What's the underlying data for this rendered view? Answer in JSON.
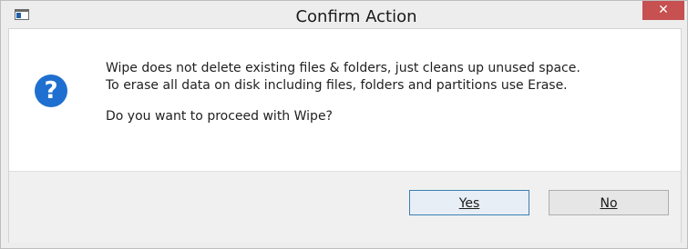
{
  "window": {
    "title": "Confirm Action",
    "close_glyph": "✕"
  },
  "icons": {
    "app": "app-window-icon",
    "question": "question-icon",
    "question_glyph": "?"
  },
  "message": {
    "line1": "Wipe does not delete existing files & folders, just cleans up unused space.",
    "line2": "To erase all data on disk including files, folders and partitions use Erase.",
    "line3": "Do you want to proceed with Wipe?"
  },
  "buttons": {
    "yes_label": "Yes",
    "no_label": "No"
  },
  "colors": {
    "close_button": "#c75050",
    "question_icon": "#1e6fd0",
    "default_button_border": "#3c7fb1"
  }
}
